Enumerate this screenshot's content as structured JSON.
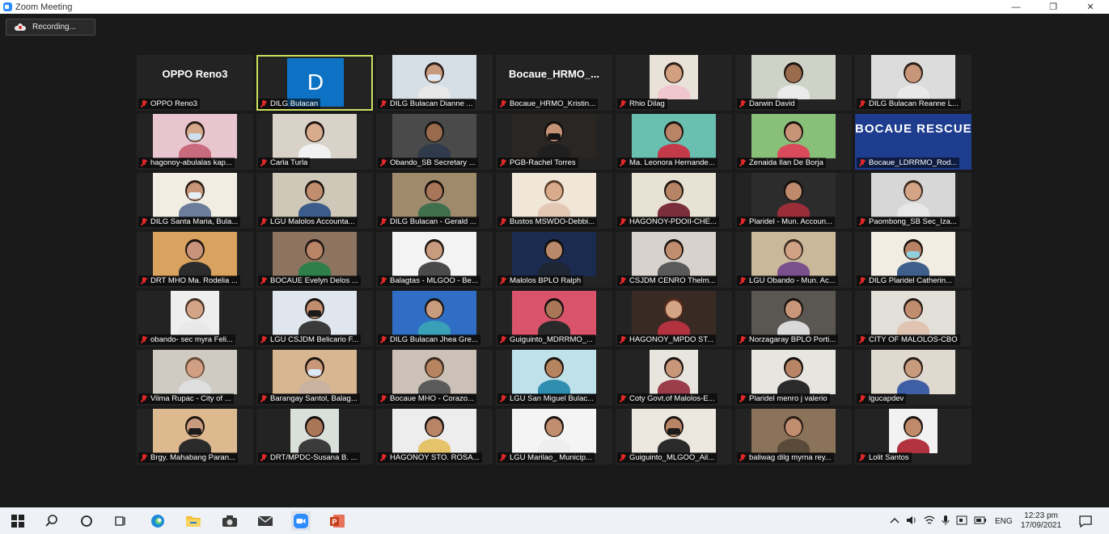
{
  "window": {
    "title": "Zoom Meeting",
    "minimize": "—",
    "maximize": "❐",
    "close": "✕"
  },
  "recording": {
    "label": "Recording..."
  },
  "participants": [
    {
      "name": "OPPO Reno3",
      "banner": "OPPO Reno3",
      "video_bg": "#232323"
    },
    {
      "name": "DILG Bulacan",
      "avatar": "D",
      "active": true,
      "video_bg": "#232323"
    },
    {
      "name": "DILG Bulacan Dianne ...",
      "video_bg": "#d6dfe6",
      "skin": "#c99b7e",
      "shirt": "#e8e8e8",
      "hair": "#2b1d16",
      "mask": "#dfe9f5"
    },
    {
      "name": "Bocaue_HRMO_Kristin...",
      "banner": "Bocaue_HRMO_...",
      "video_bg": "#232323"
    },
    {
      "name": "Rhio Dilag",
      "video_bg": "#e8e2d8",
      "skin": "#d2a07e",
      "shirt": "#f0c6cf",
      "hair": "#2b1d16",
      "narrow": true
    },
    {
      "name": "Darwin David",
      "video_bg": "#cfd2c6",
      "skin": "#9b6b4e",
      "shirt": "#eaeaea",
      "hair": "#1a1410"
    },
    {
      "name": "DILG Bulacan Reanne L...",
      "video_bg": "#dcdcdc",
      "skin": "#c8977a",
      "shirt": "#e8e8e8",
      "hair": "#2b1d16"
    },
    {
      "name": "hagonoy-abulalas kap...",
      "video_bg": "#e9c6cf",
      "skin": "#d6a98c",
      "shirt": "#c96a7d",
      "hair": "#2a1d18",
      "mask": "#cfe1f0"
    },
    {
      "name": "Carla Turla",
      "video_bg": "#d9d2c9",
      "skin": "#d8ab8d",
      "shirt": "#f1f1f1",
      "hair": "#1e1511"
    },
    {
      "name": "Obando_SB Secretary ...",
      "video_bg": "#4a4a4a",
      "skin": "#9a6a4c",
      "shirt": "#2f3a4a",
      "hair": "#111111"
    },
    {
      "name": "PGB-Rachel Torres",
      "video_bg": "#2a2624",
      "skin": "#c49275",
      "shirt": "#1f1f1f",
      "hair": "#120e0c",
      "mask": "#151515"
    },
    {
      "name": "Ma. Leonora Hernande...",
      "video_bg": "#69bfb0",
      "skin": "#b98466",
      "shirt": "#c33b4b",
      "hair": "#1c1410"
    },
    {
      "name": "Zenaida Ilan De Borja",
      "video_bg": "#88c07a",
      "skin": "#c89478",
      "shirt": "#d94a5a",
      "hair": "#1c1410"
    },
    {
      "name": "Bocaue_LDRRMO_Rod...",
      "banner": "BOCAUE RESCUE",
      "video_bg": "#1e3d8f"
    },
    {
      "name": "DILG Santa Maria, Bula...",
      "video_bg": "#f2ede3",
      "skin": "#c8977a",
      "shirt": "#6c7d9c",
      "hair": "#2b1d16",
      "mask": "#e6eef6"
    },
    {
      "name": "LGU Malolos Accounta...",
      "video_bg": "#cfc7b8",
      "skin": "#c18d6f",
      "shirt": "#3b5c8a",
      "hair": "#1a1410"
    },
    {
      "name": "DILG Bulacan - Gerald ...",
      "video_bg": "#a08a6c",
      "skin": "#a87558",
      "shirt": "#3f6f4c",
      "hair": "#120e0c"
    },
    {
      "name": "Bustos MSWDO-Debbi...",
      "video_bg": "#f1e7d9",
      "skin": "#d9aa8b",
      "shirt": "#e4c8b6",
      "hair": "#5a3f2c"
    },
    {
      "name": "HAGONOY-PDOII-CHE...",
      "video_bg": "#e7e2d3",
      "skin": "#b88466",
      "shirt": "#7a2e3c",
      "hair": "#1c1410"
    },
    {
      "name": "Plaridel - Mun. Accoun...",
      "video_bg": "#2c2c2c",
      "skin": "#bf8b6c",
      "shirt": "#9a2e38",
      "hair": "#120e0c"
    },
    {
      "name": "Paombong_SB Sec_Iza...",
      "video_bg": "#d7d7d7",
      "skin": "#d4a487",
      "shirt": "#e7e7e7",
      "hair": "#3a2a20"
    },
    {
      "name": "DRT MHO Ma. Rodelia ...",
      "video_bg": "#d9a25e",
      "skin": "#c8937a",
      "shirt": "#2c2c2c",
      "hair": "#1e1511"
    },
    {
      "name": "BOCAUE Evelyn Delos ...",
      "video_bg": "#8d7460",
      "skin": "#b98466",
      "shirt": "#2f7f4a",
      "hair": "#1c1410"
    },
    {
      "name": "Balagtas - MLGOO - Be...",
      "video_bg": "#f3f3f3",
      "skin": "#c99b7e",
      "shirt": "#4a4a4a",
      "hair": "#1e1511"
    },
    {
      "name": "Malolos BPLO Ralph",
      "video_bg": "#1b2b4f",
      "skin": "#b9896b",
      "shirt": "#1e2533",
      "hair": "#0f0c0a"
    },
    {
      "name": "CSJDM CENRO Thelm...",
      "video_bg": "#d7d3cc",
      "skin": "#c18d6f",
      "shirt": "#5a5a5a",
      "hair": "#1c1410"
    },
    {
      "name": "LGU Obando - Mun. Ac...",
      "video_bg": "#c9b89a",
      "skin": "#d2a287",
      "shirt": "#7a4f8c",
      "hair": "#3a2a20"
    },
    {
      "name": "DILG Plaridel Catherin...",
      "video_bg": "#f2ede3",
      "skin": "#b98466",
      "shirt": "#3f5f8a",
      "hair": "#1c1410",
      "mask": "#8fd0e0"
    },
    {
      "name": "obando- sec myra Feli...",
      "video_bg": "#eeeeee",
      "skin": "#d3a487",
      "shirt": "#e9e9e9",
      "hair": "#4a3628",
      "narrow": true
    },
    {
      "name": "LGU CSJDM Belicario F...",
      "video_bg": "#dfe6ee",
      "skin": "#c18d6f",
      "shirt": "#3a3a3a",
      "hair": "#1e1511",
      "mask": "#1a1a1a"
    },
    {
      "name": "DILG Bulacan Jhea Gre...",
      "video_bg": "#2f6ec4",
      "skin": "#c99b7e",
      "shirt": "#3aa0b8",
      "hair": "#1a1410"
    },
    {
      "name": "Guiguinto_MDRRMO_...",
      "video_bg": "#d9546a",
      "skin": "#a97657",
      "shirt": "#2a2a2a",
      "hair": "#120e0c"
    },
    {
      "name": "HAGONOY_MPDO ST...",
      "video_bg": "#3a2a24",
      "skin": "#d4a487",
      "shirt": "#b3323f",
      "hair": "#5a2a1a"
    },
    {
      "name": "Norzagaray BPLO Porti...",
      "video_bg": "#5a5752",
      "skin": "#c8977a",
      "shirt": "#d9d9d9",
      "hair": "#1c1410"
    },
    {
      "name": "CITY OF MALOLOS-CBO",
      "video_bg": "#e3e0da",
      "skin": "#c18d6f",
      "shirt": "#e1c3b2",
      "hair": "#2a1d18"
    },
    {
      "name": "Vilma Rupac - City of ...",
      "video_bg": "#cfcac2",
      "skin": "#d1a084",
      "shirt": "#dedede",
      "hair": "#6a4c36"
    },
    {
      "name": "Barangay Santol, Balag...",
      "video_bg": "#d8b691",
      "skin": "#c8977a",
      "shirt": "#c9b3a0",
      "hair": "#1c1410",
      "mask": "#dbeaf7"
    },
    {
      "name": "Bocaue MHO - Corazo...",
      "video_bg": "#cbc1b6",
      "skin": "#b6845f",
      "shirt": "#5a5a5a",
      "hair": "#3a2a20"
    },
    {
      "name": "LGU San Miguel Bulac...",
      "video_bg": "#bfe1ea",
      "skin": "#b6845f",
      "shirt": "#2f8fb0",
      "hair": "#1c1410"
    },
    {
      "name": "Coty Govt.of Malolos-E...",
      "video_bg": "#e8e5de",
      "skin": "#c8977a",
      "shirt": "#9a3c4a",
      "hair": "#1c1410",
      "narrow": true
    },
    {
      "name": "Plaridel menro j valerio",
      "video_bg": "#e7e5e0",
      "skin": "#b98466",
      "shirt": "#2a2a2a",
      "hair": "#120e0c"
    },
    {
      "name": "lgucapdev",
      "video_bg": "#dfd9cf",
      "skin": "#c99b7e",
      "shirt": "#3f5fa4",
      "hair": "#2a1d18"
    },
    {
      "name": "Brgy. Mahabang Paran...",
      "video_bg": "#dcb98f",
      "skin": "#c99b7e",
      "shirt": "#2a2a2a",
      "hair": "#1e1511",
      "mask": "#1a1a1a"
    },
    {
      "name": "DRT/MPDC-Susana B. ...",
      "video_bg": "#d9e0d9",
      "skin": "#a97657",
      "shirt": "#3b3b3b",
      "hair": "#120e0c",
      "narrow": true
    },
    {
      "name": "HAGONOY STO. ROSA...",
      "video_bg": "#ededed",
      "skin": "#b98466",
      "shirt": "#e4c36a",
      "hair": "#120e0c"
    },
    {
      "name": "LGU Marilao_ Municip...",
      "video_bg": "#f4f4f4",
      "skin": "#c18d6f",
      "shirt": "#eeeeee",
      "hair": "#1a1410"
    },
    {
      "name": "Guiguinto_MLGOO_Ail...",
      "video_bg": "#ece8df",
      "skin": "#b98466",
      "shirt": "#2a2a2a",
      "hair": "#1c1410",
      "mask": "#1a1a1a"
    },
    {
      "name": "baliwag dilg myrna rey...",
      "video_bg": "#8a7358",
      "skin": "#c18d6f",
      "shirt": "#5a4a3a",
      "hair": "#2a1d18"
    },
    {
      "name": "Lolit Santos",
      "video_bg": "#f2f2f2",
      "skin": "#c08a6a",
      "shirt": "#b3323f",
      "hair": "#1c1410",
      "narrow": true
    }
  ],
  "taskbar": {
    "clock_time": "12:23 pm",
    "clock_date": "17/09/2021",
    "language": "ENG"
  },
  "colors": {
    "active_speaker_border": "#cde05e",
    "avatar_bg": "#0e72c4",
    "muted_mic": "#e02828"
  }
}
